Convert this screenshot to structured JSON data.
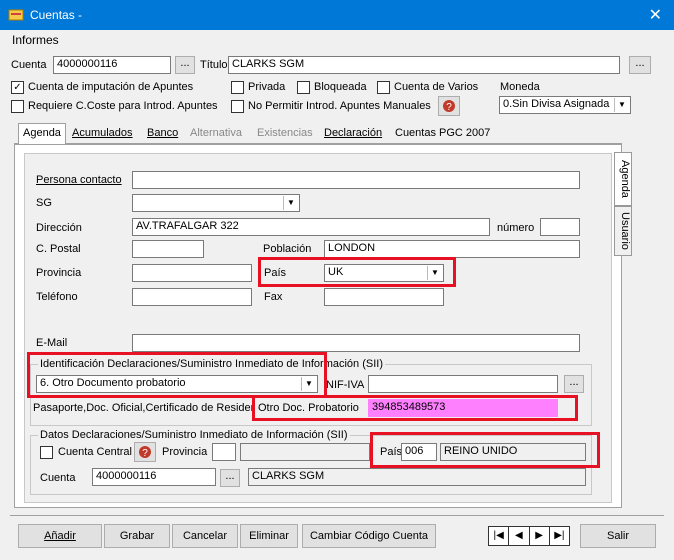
{
  "window": {
    "title": "Cuentas -",
    "close": "✕"
  },
  "menu": {
    "informes": "Informes"
  },
  "header": {
    "cuenta_label": "Cuenta",
    "cuenta_value": "4000000116",
    "titulo_label": "Título",
    "titulo_value": "CLARKS SGM",
    "ellipsis": "..."
  },
  "checks": {
    "imputacion": "Cuenta de imputación de Apuntes",
    "privada": "Privada",
    "bloqueada": "Bloqueada",
    "varios": "Cuenta de Varios",
    "ccoste": "Requiere C.Coste para Introd. Apuntes",
    "no_permitir": "No Permitir Introd. Apuntes Manuales"
  },
  "moneda": {
    "label": "Moneda",
    "value": "0.Sin Divisa Asignada"
  },
  "tabs": [
    "Agenda",
    "Acumulados",
    "Banco",
    "Alternativa",
    "Existencias",
    "Declaración",
    "Cuentas PGC 2007"
  ],
  "side_tabs": [
    "Agenda",
    "Usuario"
  ],
  "agenda": {
    "persona_contacto": "Persona contacto",
    "sg": "SG",
    "direccion": "Dirección",
    "direccion_value": "AV.TRAFALGAR 322",
    "numero": "número",
    "cpostal": "C. Postal",
    "poblacion": "Población",
    "poblacion_value": "LONDON",
    "provincia": "Provincia",
    "pais": "País",
    "pais_value": "UK",
    "telefono": "Teléfono",
    "fax": "Fax",
    "email": "E-Mail"
  },
  "sii": {
    "title": "Identificación Declaraciones/Suministro Inmediato de Información (SII)",
    "tipo_value": "6. Otro Documento probatorio",
    "nif_label": "NIF-IVA",
    "pasaporte_label": "Pasaporte,Doc. Oficial,Certificado de Residencia",
    "otro_doc_label": "Otro Doc. Probatorio",
    "otro_doc_value": "394853489573"
  },
  "datos_sii": {
    "title": "Datos Declaraciones/Suministro Inmediato de Información (SII)",
    "cuenta_central": "Cuenta Central",
    "provincia": "Provincia",
    "pais_label": "País",
    "pais_code": "006",
    "pais_name": "REINO UNIDO",
    "cuenta_label": "Cuenta",
    "cuenta_value": "4000000116",
    "cuenta_name": "CLARKS SGM"
  },
  "buttons": {
    "anadir": "Añadir",
    "grabar": "Grabar",
    "cancelar": "Cancelar",
    "eliminar": "Eliminar",
    "cambiar": "Cambiar Código Cuenta",
    "salir": "Salir"
  },
  "nav": [
    "|◀",
    "◀",
    "▶",
    "▶|"
  ],
  "colors": {
    "titlebar": "#0078d7",
    "highlight": "#e81123",
    "otro_doc_bg": "#ff80ff"
  }
}
